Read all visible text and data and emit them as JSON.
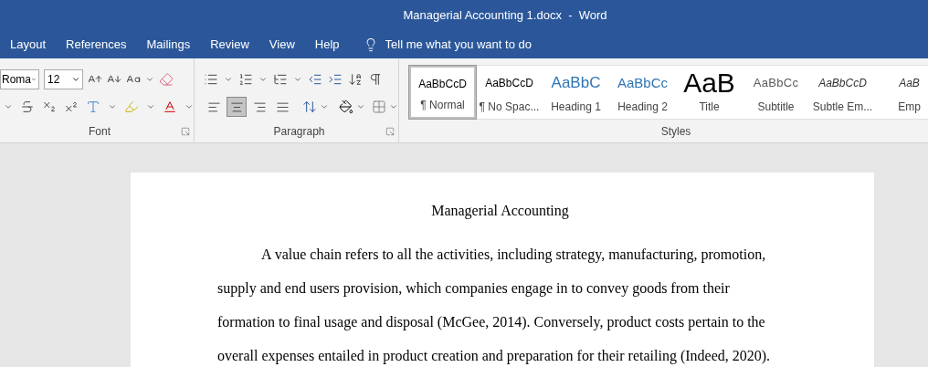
{
  "window": {
    "title": "Managerial Accounting 1.docx  -  Word"
  },
  "tabs": [
    {
      "label": "Layout",
      "selected": false
    },
    {
      "label": "References",
      "selected": false
    },
    {
      "label": "Mailings",
      "selected": false
    },
    {
      "label": "Review",
      "selected": false
    },
    {
      "label": "View",
      "selected": false
    },
    {
      "label": "Help",
      "selected": false
    }
  ],
  "tell_me": {
    "placeholder": "Tell me what you want to do"
  },
  "font_group": {
    "label": "Font",
    "font_name": "Roma",
    "font_size": "12"
  },
  "paragraph_group": {
    "label": "Paragraph",
    "alignments": [
      {
        "kind": "left",
        "selected": false
      },
      {
        "kind": "center",
        "selected": true
      },
      {
        "kind": "right",
        "selected": false
      },
      {
        "kind": "justify",
        "selected": false
      }
    ]
  },
  "styles_group": {
    "label": "Styles",
    "styles": [
      {
        "kind": "normal",
        "preview": "AaBbCcD",
        "name": "¶ Normal",
        "selected": true
      },
      {
        "kind": "normal",
        "preview": "AaBbCcD",
        "name": "¶ No Spac...",
        "selected": false
      },
      {
        "kind": "heading1",
        "preview": "AaBbC",
        "name": "Heading 1",
        "selected": false
      },
      {
        "kind": "heading2",
        "preview": "AaBbCc",
        "name": "Heading 2",
        "selected": false
      },
      {
        "kind": "title",
        "preview": "AaB",
        "name": "Title",
        "selected": false
      },
      {
        "kind": "subtitle",
        "preview": "AaBbCc",
        "name": "Subtitle",
        "selected": false
      },
      {
        "kind": "italic",
        "preview": "AaBbCcD",
        "name": "Subtle Em...",
        "selected": false
      },
      {
        "kind": "italic",
        "preview": "AaB",
        "name": "Emp",
        "selected": false
      }
    ]
  },
  "document": {
    "title": "Managerial Accounting",
    "paragraphs": [
      "A value chain refers to all the activities, including strategy, manufacturing, promotion, supply and end users provision, which companies engage in to convey goods from their formation to final usage and disposal (McGee, 2014). Conversely, product costs pertain to the overall expenses entailed in product creation and preparation for their retailing (Indeed, 2020)."
    ]
  }
}
